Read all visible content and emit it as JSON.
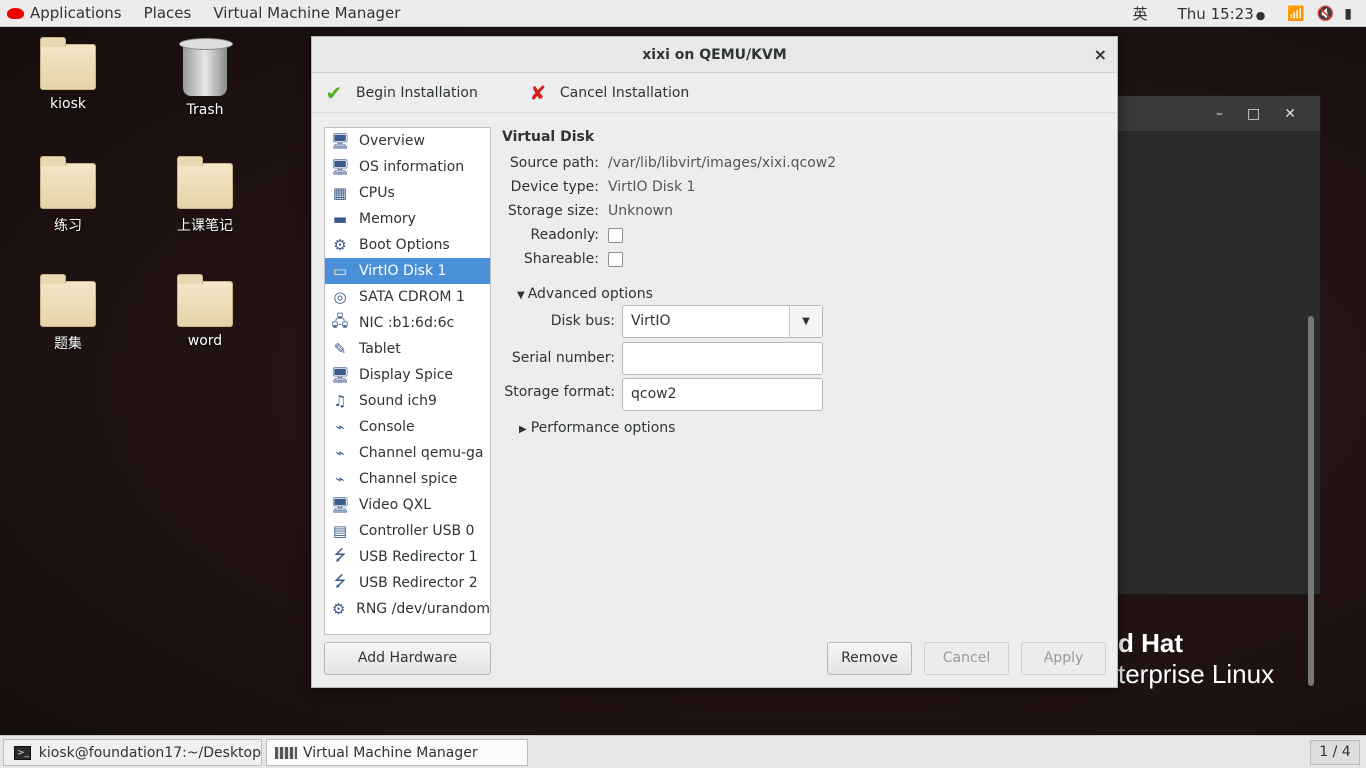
{
  "topbar": {
    "applications": "Applications",
    "places": "Places",
    "app_menu": "Virtual Machine Manager",
    "input_method": "英",
    "clock": "Thu 15:23",
    "indicator": "●"
  },
  "desktop": {
    "icons": [
      {
        "label": "kiosk"
      },
      {
        "label": "Trash"
      },
      {
        "label": "练习"
      },
      {
        "label": "上课笔记"
      },
      {
        "label": "题集"
      },
      {
        "label": "word"
      }
    ],
    "brand_line1": "d Hat",
    "brand_line2": "terprise Linux"
  },
  "dialog": {
    "title": "xixi on QEMU/KVM",
    "close": "×",
    "toolbar": {
      "begin": "Begin Installation",
      "cancel": "Cancel Installation"
    },
    "hardware": [
      {
        "label": "Overview",
        "icon": "monitor-icon"
      },
      {
        "label": "OS information",
        "icon": "monitor-icon"
      },
      {
        "label": "CPUs",
        "icon": "cpu-icon"
      },
      {
        "label": "Memory",
        "icon": "memory-icon"
      },
      {
        "label": "Boot Options",
        "icon": "gear-icon"
      },
      {
        "label": "VirtIO Disk 1",
        "icon": "disk-icon"
      },
      {
        "label": "SATA CDROM 1",
        "icon": "cdrom-icon"
      },
      {
        "label": "NIC :b1:6d:6c",
        "icon": "network-icon"
      },
      {
        "label": "Tablet",
        "icon": "tablet-icon"
      },
      {
        "label": "Display Spice",
        "icon": "monitor-icon"
      },
      {
        "label": "Sound ich9",
        "icon": "sound-icon"
      },
      {
        "label": "Console",
        "icon": "serial-icon"
      },
      {
        "label": "Channel qemu-ga",
        "icon": "serial-icon"
      },
      {
        "label": "Channel spice",
        "icon": "serial-icon"
      },
      {
        "label": "Video QXL",
        "icon": "monitor-icon"
      },
      {
        "label": "Controller USB 0",
        "icon": "controller-icon"
      },
      {
        "label": "USB Redirector 1",
        "icon": "usb-icon"
      },
      {
        "label": "USB Redirector 2",
        "icon": "usb-icon"
      },
      {
        "label": "RNG /dev/urandom",
        "icon": "gear-icon"
      }
    ],
    "add_hardware": "Add Hardware",
    "details": {
      "section": "Virtual Disk",
      "source_path_label": "Source path:",
      "source_path": "/var/lib/libvirt/images/xixi.qcow2",
      "device_type_label": "Device type:",
      "device_type": "VirtIO Disk 1",
      "storage_size_label": "Storage size:",
      "storage_size": "Unknown",
      "readonly_label": "Readonly:",
      "readonly": false,
      "shareable_label": "Shareable:",
      "shareable": false,
      "advanced": "Advanced options",
      "disk_bus_label": "Disk bus:",
      "disk_bus": "VirtIO",
      "serial_label": "Serial number:",
      "serial": "",
      "storage_format_label": "Storage format:",
      "storage_format": "qcow2",
      "performance": "Performance options"
    },
    "buttons": {
      "remove": "Remove",
      "cancel": "Cancel",
      "apply": "Apply"
    }
  },
  "taskbar": {
    "terminal": "kiosk@foundation17:~/Desktop",
    "vmm": "Virtual Machine Manager",
    "workspace": "1 / 4"
  },
  "colors": {
    "selection": "#4a90d9",
    "check": "#4caf1f",
    "cancel_x": "#d42020"
  }
}
